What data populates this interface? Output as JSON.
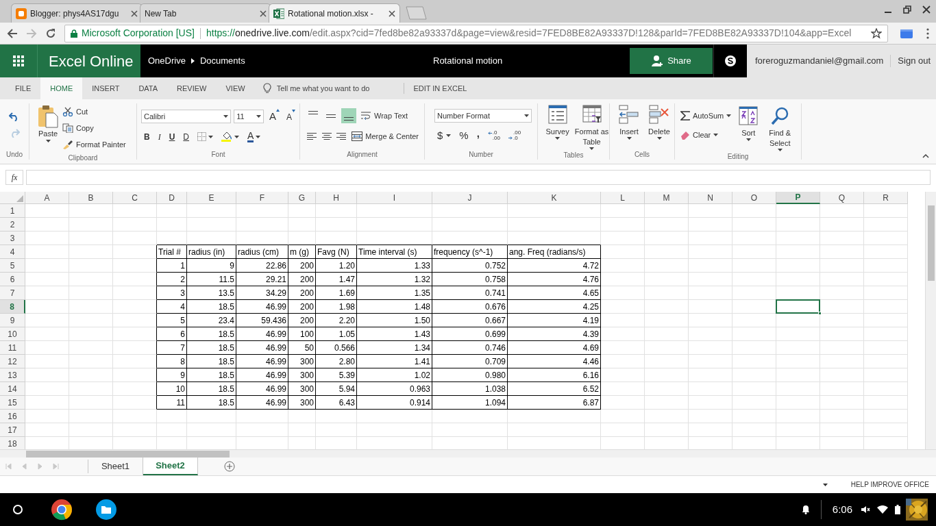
{
  "browser": {
    "tabs": [
      {
        "title": "Blogger: phys4AS17dgu",
        "kind": "blogger",
        "selected": false
      },
      {
        "title": "New Tab",
        "kind": "blank",
        "selected": false
      },
      {
        "title": "Rotational motion.xlsx -",
        "kind": "excel",
        "selected": true
      }
    ],
    "omnibox": {
      "identity": "Microsoft Corporation [US]",
      "scheme": "https://",
      "host": "onedrive.live.com",
      "path": "/edit.aspx?cid=7fed8be82a93337d&page=view&resid=7FED8BE82A93337D!128&parId=7FED8BE82A93337D!104&app=Excel"
    }
  },
  "app": {
    "name": "Excel Online",
    "breadcrumb": [
      "OneDrive",
      "Documents"
    ],
    "document_title": "Rotational motion",
    "share": "Share",
    "account": "foreroguzmandaniel@gmail.com",
    "sign_out": "Sign out"
  },
  "ribbon_tabs": [
    {
      "label": "FILE",
      "selected": false
    },
    {
      "label": "HOME",
      "selected": true
    },
    {
      "label": "INSERT",
      "selected": false
    },
    {
      "label": "DATA",
      "selected": false
    },
    {
      "label": "REVIEW",
      "selected": false
    },
    {
      "label": "VIEW",
      "selected": false
    }
  ],
  "tell_me": "Tell me what you want to do",
  "edit_in_excel": "EDIT IN EXCEL",
  "ribbon": {
    "undo": {
      "label": "Undo",
      "redo_disabled": true
    },
    "clipboard": {
      "label": "Clipboard",
      "paste": "Paste",
      "cut": "Cut",
      "copy": "Copy",
      "format_painter": "Format Painter"
    },
    "font": {
      "label": "Font",
      "name": "Calibri",
      "size": "11",
      "grow": "A",
      "shrink": "A",
      "styles": [
        "B",
        "I",
        "U",
        "D"
      ],
      "font_color": "A"
    },
    "alignment": {
      "label": "Alignment",
      "buttons": [
        {
          "kind": "top",
          "selected": false
        },
        {
          "kind": "middle",
          "selected": false
        },
        {
          "kind": "bottom",
          "selected": true
        },
        {
          "kind": "left",
          "selected": false
        },
        {
          "kind": "center",
          "selected": false
        },
        {
          "kind": "right",
          "selected": false
        }
      ],
      "wrap_text": "Wrap Text",
      "merge": "Merge & Center"
    },
    "number": {
      "label": "Number",
      "format": "Number Format",
      "currency": "$",
      "percent": "%",
      "comma": ",",
      "increase_decimal": [
        ".0",
        ".00"
      ],
      "decrease_decimal": [
        ".00",
        ".0"
      ]
    },
    "tables": {
      "label": "Tables",
      "survey": "Survey",
      "format_as_table": "Format as Table"
    },
    "cells": {
      "label": "Cells",
      "insert": "Insert",
      "delete": "Delete"
    },
    "editing": {
      "label": "Editing",
      "autosum": "AutoSum",
      "clear": "Clear",
      "sort": "Sort",
      "find_select": "Find & Select"
    }
  },
  "formula_bar": {
    "label": "fx"
  },
  "sheet": {
    "columns": [
      {
        "label": "A",
        "selected": false
      },
      {
        "label": "B",
        "selected": false
      },
      {
        "label": "C",
        "selected": false
      },
      {
        "label": "D",
        "selected": false
      },
      {
        "label": "E",
        "selected": false
      },
      {
        "label": "F",
        "selected": false
      },
      {
        "label": "G",
        "selected": false
      },
      {
        "label": "H",
        "selected": false
      },
      {
        "label": "I",
        "selected": false
      },
      {
        "label": "J",
        "selected": false
      },
      {
        "label": "K",
        "selected": false
      },
      {
        "label": "L",
        "selected": false
      },
      {
        "label": "M",
        "selected": false
      },
      {
        "label": "N",
        "selected": false
      },
      {
        "label": "O",
        "selected": false
      },
      {
        "label": "P",
        "selected": true
      },
      {
        "label": "Q",
        "selected": false
      },
      {
        "label": "R",
        "selected": false
      }
    ],
    "rows": [
      {
        "label": "1",
        "selected": false
      },
      {
        "label": "2",
        "selected": false
      },
      {
        "label": "3",
        "selected": false
      },
      {
        "label": "4",
        "selected": false
      },
      {
        "label": "5",
        "selected": false
      },
      {
        "label": "6",
        "selected": false
      },
      {
        "label": "7",
        "selected": false
      },
      {
        "label": "8",
        "selected": true
      },
      {
        "label": "9",
        "selected": false
      },
      {
        "label": "10",
        "selected": false
      },
      {
        "label": "11",
        "selected": false
      },
      {
        "label": "12",
        "selected": false
      },
      {
        "label": "13",
        "selected": false
      },
      {
        "label": "14",
        "selected": false
      },
      {
        "label": "15",
        "selected": false
      },
      {
        "label": "16",
        "selected": false
      },
      {
        "label": "17",
        "selected": false
      },
      {
        "label": "18",
        "selected": false
      }
    ]
  },
  "table": {
    "columns": [
      "Trial #",
      "radius (in)",
      "radius (cm)",
      "m (g)",
      "Favg (N)",
      "Time interval (s)",
      "frequency (s^-1)",
      "ang. Freq (radians/s)"
    ],
    "rows": [
      [
        "1",
        "9",
        "22.86",
        "200",
        "1.20",
        "1.33",
        "0.752",
        "4.72"
      ],
      [
        "2",
        "11.5",
        "29.21",
        "200",
        "1.47",
        "1.32",
        "0.758",
        "4.76"
      ],
      [
        "3",
        "13.5",
        "34.29",
        "200",
        "1.69",
        "1.35",
        "0.741",
        "4.65"
      ],
      [
        "4",
        "18.5",
        "46.99",
        "200",
        "1.98",
        "1.48",
        "0.676",
        "4.25"
      ],
      [
        "5",
        "23.4",
        "59.436",
        "200",
        "2.20",
        "1.50",
        "0.667",
        "4.19"
      ],
      [
        "6",
        "18.5",
        "46.99",
        "100",
        "1.05",
        "1.43",
        "0.699",
        "4.39"
      ],
      [
        "7",
        "18.5",
        "46.99",
        "50",
        "0.566",
        "1.34",
        "0.746",
        "4.69"
      ],
      [
        "8",
        "18.5",
        "46.99",
        "300",
        "2.80",
        "1.41",
        "0.709",
        "4.46"
      ],
      [
        "9",
        "18.5",
        "46.99",
        "300",
        "5.39",
        "1.02",
        "0.980",
        "6.16"
      ],
      [
        "10",
        "18.5",
        "46.99",
        "300",
        "5.94",
        "0.963",
        "1.038",
        "6.52"
      ],
      [
        "11",
        "18.5",
        "46.99",
        "300",
        "6.43",
        "0.914",
        "1.094",
        "6.87"
      ]
    ]
  },
  "sheet_tabs": [
    {
      "label": "Sheet1",
      "selected": false
    },
    {
      "label": "Sheet2",
      "selected": true
    }
  ],
  "status_bar": {
    "feedback": "HELP IMPROVE OFFICE"
  },
  "taskbar": {
    "time": "6:06"
  }
}
